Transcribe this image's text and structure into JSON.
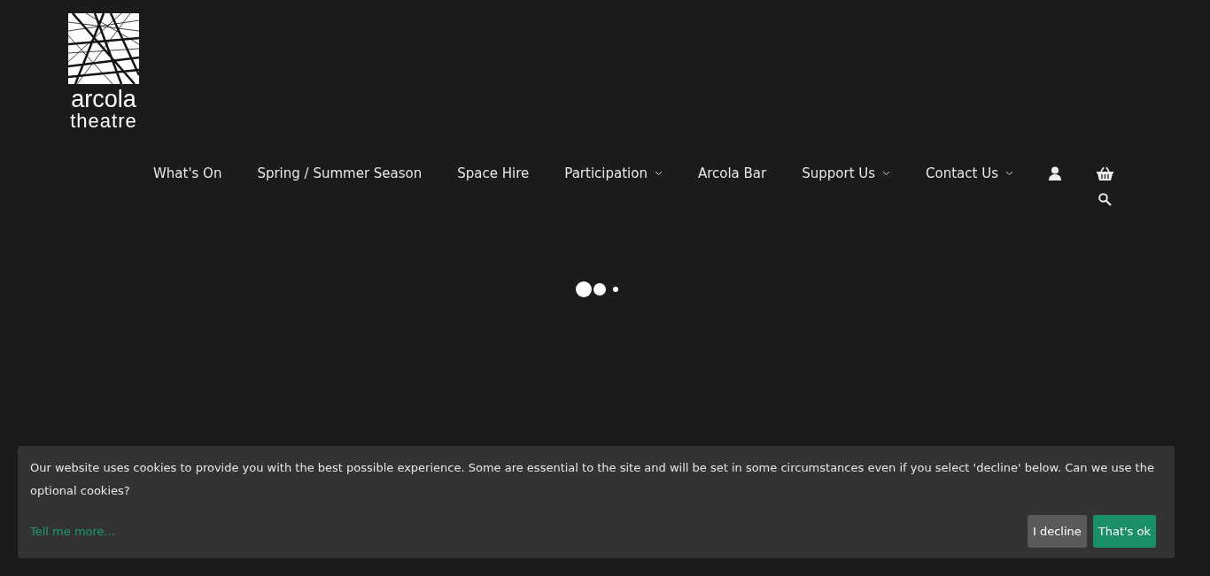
{
  "logo": {
    "line_1": "arcola",
    "line_2": "theatre"
  },
  "nav": {
    "items": [
      {
        "label": "What's On",
        "has_dropdown": false
      },
      {
        "label": "Spring / Summer Season",
        "has_dropdown": false
      },
      {
        "label": "Space Hire",
        "has_dropdown": false
      },
      {
        "label": "Participation",
        "has_dropdown": true
      },
      {
        "label": "Arcola Bar",
        "has_dropdown": false
      },
      {
        "label": "Support Us",
        "has_dropdown": true
      },
      {
        "label": "Contact Us",
        "has_dropdown": true
      }
    ]
  },
  "cookie_banner": {
    "message": "Our website uses cookies to provide you with the best possible experience. Some are essential to the site and will be set in some circumstances even if you select 'decline' below. Can we use the optional cookies?",
    "link": "Tell me more...",
    "buttons": [
      {
        "label": "I decline",
        "kind": "decline"
      },
      {
        "label": "That's ok",
        "kind": "accept"
      }
    ]
  }
}
